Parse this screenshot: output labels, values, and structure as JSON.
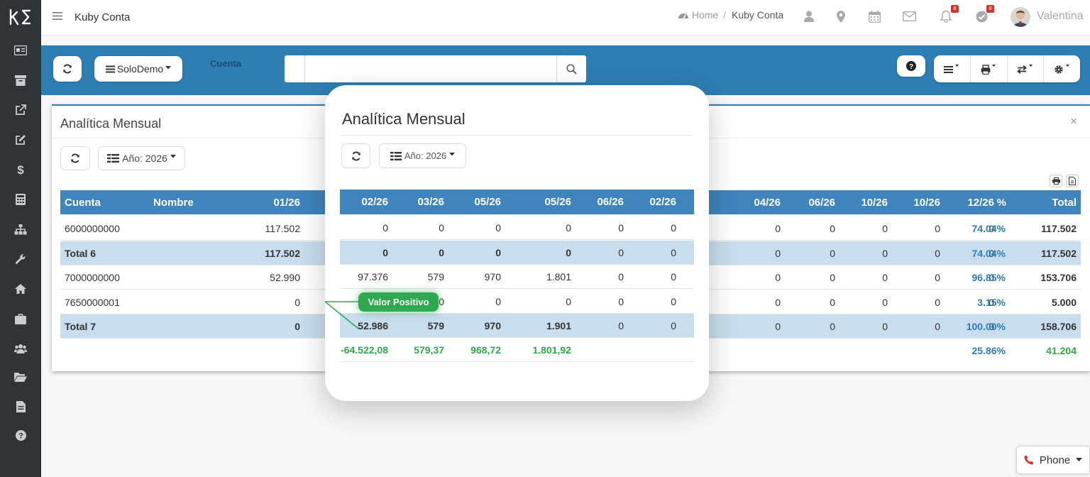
{
  "app": {
    "logo_text": "kS",
    "title": "Kuby Conta"
  },
  "sidebar": {
    "items": [
      {
        "icon": "id-card-icon"
      },
      {
        "icon": "archive-icon"
      },
      {
        "icon": "external-link-icon"
      },
      {
        "icon": "edit-icon"
      },
      {
        "icon": "dollar-icon"
      },
      {
        "icon": "calculator-icon"
      },
      {
        "icon": "sitemap-icon"
      },
      {
        "icon": "wrench-icon"
      },
      {
        "icon": "home-icon"
      },
      {
        "icon": "briefcase-icon"
      },
      {
        "icon": "users-icon"
      },
      {
        "icon": "folder-open-icon"
      },
      {
        "icon": "file-icon"
      },
      {
        "icon": "question-icon"
      }
    ]
  },
  "header": {
    "breadcrumb": {
      "home": "Home",
      "separator": "/",
      "current": "Kuby Conta"
    },
    "icons": [
      "user-icon",
      "map-marker-icon",
      "calendar-icon",
      "envelope-icon",
      "bell-icon",
      "check-badge-icon"
    ],
    "notifications_badge": "8",
    "tasks_badge": "8",
    "user_name": "Valentina"
  },
  "toolbar": {
    "company_label": "SoloDemo",
    "cuenta_label": "Cuenta",
    "search_value": "",
    "search_placeholder": ""
  },
  "panel": {
    "title": "Analítica Mensual",
    "close": "×",
    "year_label": "Año: 2026",
    "columns": [
      "Cuenta",
      "Nombre",
      "01/26",
      "04/26",
      "06/26",
      "10/26",
      "10/26",
      "12/26",
      "%",
      "Total"
    ],
    "rows": [
      {
        "cuenta": "6000000000",
        "c01": "117.502",
        "m": [
          "0",
          "0",
          "0",
          "0",
          "0"
        ],
        "pct": "74.04%",
        "total": "117.502",
        "is_total": false
      },
      {
        "cuenta": "Total 6",
        "c01": "117.502",
        "m": [
          "0",
          "0",
          "0",
          "0",
          "0"
        ],
        "pct": "74.04%",
        "total": "117.502",
        "is_total": true
      },
      {
        "cuenta": "7000000000",
        "c01": "52.990",
        "m": [
          "0",
          "0",
          "0",
          "0",
          "0"
        ],
        "pct": "96.85%",
        "total": "153.706",
        "is_total": false
      },
      {
        "cuenta": "7650000001",
        "c01": "0",
        "m": [
          "0",
          "0",
          "0",
          "0",
          "0"
        ],
        "pct": "3.15%",
        "total": "5.000",
        "is_total": false
      },
      {
        "cuenta": "Total 7",
        "c01": "0",
        "m": [
          "0",
          "0",
          "0",
          "0",
          "0"
        ],
        "pct": "100.00%",
        "total": "158.706",
        "is_total": true
      }
    ],
    "footer": {
      "pct": "25.86%",
      "total": "41.204"
    }
  },
  "popup": {
    "title": "Analítica Mensual",
    "year_label": "Año: 2026",
    "columns": [
      "02/26",
      "03/26",
      "05/26",
      "05/26",
      "06/26",
      "02/26"
    ],
    "rows": [
      {
        "v": [
          "0",
          "0",
          "0",
          "0",
          "0",
          "0"
        ],
        "is_total": false
      },
      {
        "v": [
          "0",
          "0",
          "0",
          "0",
          "0",
          "0"
        ],
        "is_total": true
      },
      {
        "v": [
          "97.376",
          "579",
          "970",
          "1.801",
          "0",
          "0"
        ],
        "is_total": false
      },
      {
        "v": [
          "",
          "0",
          "0",
          "0",
          "0",
          "0"
        ],
        "is_total": false
      },
      {
        "v": [
          "52.986",
          "579",
          "970",
          "1.901",
          "0",
          "0"
        ],
        "is_total": true
      }
    ],
    "footer": [
      "-64.522,08",
      "579,37",
      "968,72",
      "1.801,92",
      "",
      ""
    ]
  },
  "callout": {
    "label": "Valor Positivo"
  },
  "phone_widget": {
    "label": "Phone"
  },
  "colors": {
    "sidebar": "#2f3439",
    "accent": "#2e7db3",
    "table_header": "#3f84bc",
    "total_row": "#c8dded",
    "positive": "#2ea84a",
    "badge": "#d9342b"
  }
}
